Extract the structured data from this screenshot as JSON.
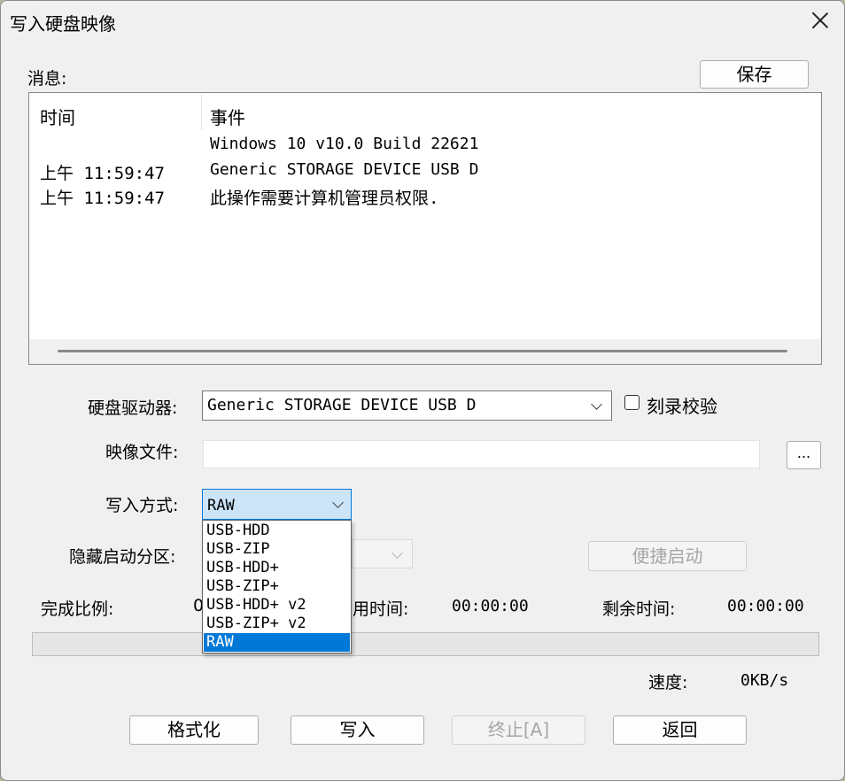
{
  "window": {
    "title": "写入硬盘映像",
    "close_label": ""
  },
  "messages": {
    "label": "消息:",
    "save_button": "保存",
    "columns": [
      "时间",
      "事件"
    ],
    "rows": [
      {
        "time": "",
        "event": "Windows 10 v10.0 Build 22621"
      },
      {
        "time": "上午 11:59:47",
        "event": "Generic STORAGE DEVICE USB D"
      },
      {
        "time": "上午 11:59:47",
        "event": "此操作需要计算机管理员权限."
      }
    ]
  },
  "form": {
    "drive_label": "硬盘驱动器:",
    "drive_value": "Generic STORAGE DEVICE USB D",
    "verify_label": "刻录校验",
    "image_label": "映像文件:",
    "image_value": "",
    "browse_button": "...",
    "write_mode_label": "写入方式:",
    "write_mode_value": "RAW",
    "write_mode_options": [
      "USB-HDD",
      "USB-ZIP",
      "USB-HDD+",
      "USB-ZIP+",
      "USB-HDD+ v2",
      "USB-ZIP+ v2",
      "RAW"
    ],
    "hidden_boot_label": "隐藏启动分区:",
    "quick_boot_button": "便捷启动"
  },
  "status": {
    "progress_label": "完成比例:",
    "progress_value_partial": "0",
    "elapsed_label_partial": "用时间:",
    "elapsed_value": "00:00:00",
    "remaining_label": "剩余时间:",
    "remaining_value": "00:00:00",
    "progress_fraction": 0,
    "speed_label": "速度:",
    "speed_value": "0KB/s"
  },
  "buttons": {
    "format": "格式化",
    "write": "写入",
    "abort": "终止[A]",
    "back": "返回"
  },
  "colors": {
    "selection": "#0078d7",
    "dialog_bg": "#f0f0f0"
  }
}
